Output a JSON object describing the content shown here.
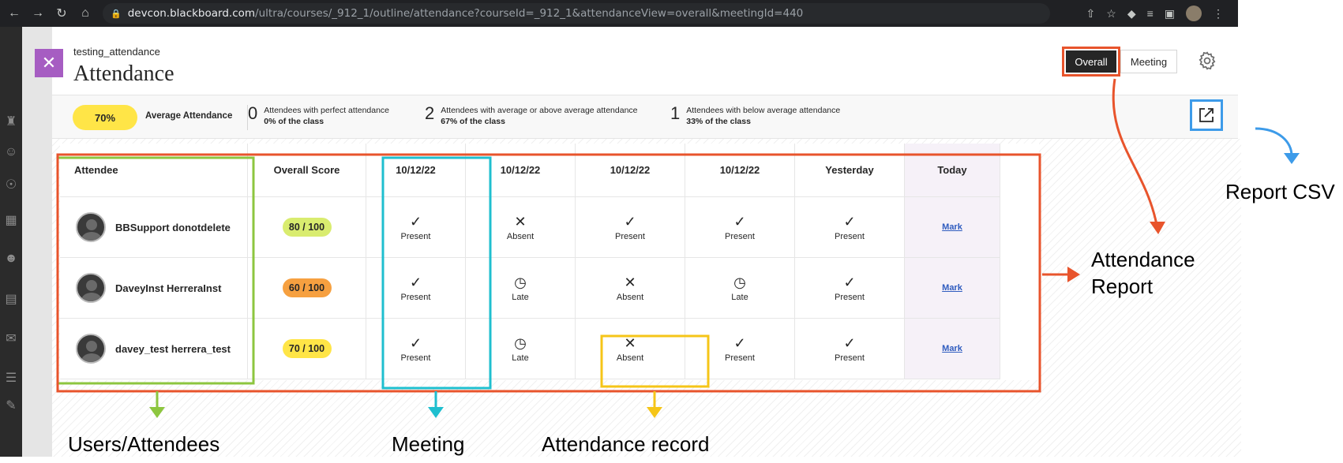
{
  "browser": {
    "url_host": "devcon.blackboard.com",
    "url_path": "/ultra/courses/_912_1/outline/attendance?courseId=_912_1&attendanceView=overall&meetingId=440"
  },
  "panel": {
    "course_name": "testing_attendance",
    "title": "Attendance",
    "toggle_overall": "Overall",
    "toggle_meeting": "Meeting"
  },
  "stats": {
    "average_pct": "70%",
    "average_label": "Average Attendance",
    "perfect": {
      "num": "0",
      "label": "Attendees with perfect attendance",
      "pct": "0% of the class"
    },
    "above": {
      "num": "2",
      "label": "Attendees with average or above average attendance",
      "pct": "67% of the class"
    },
    "below": {
      "num": "1",
      "label": "Attendees with below average attendance",
      "pct": "33% of the class"
    }
  },
  "table": {
    "headers": [
      "Attendee",
      "Overall Score",
      "10/12/22",
      "10/12/22",
      "10/12/22",
      "10/12/22",
      "Yesterday",
      "Today"
    ],
    "rows": [
      {
        "name": "BBSupport donotdelete",
        "score": "80 / 100",
        "score_color": "#d9ec6f",
        "records": [
          {
            "icon": "✓",
            "label": "Present"
          },
          {
            "icon": "✕",
            "label": "Absent"
          },
          {
            "icon": "✓",
            "label": "Present"
          },
          {
            "icon": "✓",
            "label": "Present"
          },
          {
            "icon": "✓",
            "label": "Present"
          }
        ],
        "mark": "Mark"
      },
      {
        "name": "DaveyInst HerreraInst",
        "score": "60 / 100",
        "score_color": "#f6a040",
        "records": [
          {
            "icon": "✓",
            "label": "Present"
          },
          {
            "icon": "◷",
            "label": "Late"
          },
          {
            "icon": "✕",
            "label": "Absent"
          },
          {
            "icon": "◷",
            "label": "Late"
          },
          {
            "icon": "✓",
            "label": "Present"
          }
        ],
        "mark": "Mark"
      },
      {
        "name": "davey_test herrera_test",
        "score": "70 / 100",
        "score_color": "#ffe547",
        "records": [
          {
            "icon": "✓",
            "label": "Present"
          },
          {
            "icon": "◷",
            "label": "Late"
          },
          {
            "icon": "✕",
            "label": "Absent"
          },
          {
            "icon": "✓",
            "label": "Present"
          },
          {
            "icon": "✓",
            "label": "Present"
          }
        ],
        "mark": "Mark"
      }
    ]
  },
  "annotations": {
    "report_csv": "Report CSV",
    "attendance_report_line1": "Attendance",
    "attendance_report_line2": "Report",
    "users": "Users/Attendees",
    "meeting": "Meeting",
    "record": "Attendance record"
  },
  "colors": {
    "green": "#8dc63f",
    "cyan": "#1fbfcf",
    "yellow": "#f5c518",
    "orange": "#e8542c",
    "blue": "#3d9be9"
  }
}
